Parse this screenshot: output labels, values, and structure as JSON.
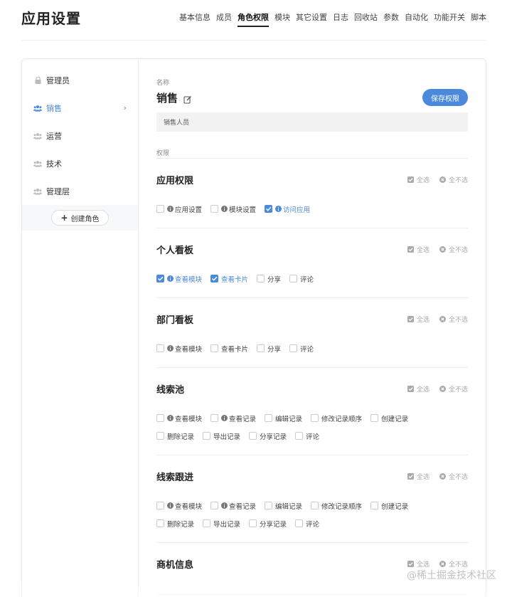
{
  "header": {
    "title": "应用设置",
    "tabs": [
      {
        "label": "基本信息",
        "active": false
      },
      {
        "label": "成员",
        "active": false
      },
      {
        "label": "角色权限",
        "active": true
      },
      {
        "label": "模块",
        "active": false
      },
      {
        "label": "其它设置",
        "active": false
      },
      {
        "label": "日志",
        "active": false
      },
      {
        "label": "回收站",
        "active": false
      },
      {
        "label": "参数",
        "active": false
      },
      {
        "label": "自动化",
        "active": false
      },
      {
        "label": "功能开关",
        "active": false
      },
      {
        "label": "脚本",
        "active": false
      }
    ]
  },
  "sidebar": {
    "roles": [
      {
        "label": "管理员",
        "icon": "lock-icon",
        "active": false
      },
      {
        "label": "销售",
        "icon": "users-icon",
        "active": true
      },
      {
        "label": "运营",
        "icon": "users-icon",
        "active": false
      },
      {
        "label": "技术",
        "icon": "users-icon",
        "active": false
      },
      {
        "label": "管理层",
        "icon": "users-icon",
        "active": false
      }
    ],
    "chevron": "›",
    "create_label": "创建角色"
  },
  "role": {
    "name_label": "名称",
    "name": "销售",
    "description": "销售人员",
    "save_label": "保存权限",
    "permissions_label": "权限"
  },
  "select_all_label": "全选",
  "deselect_all_label": "全不选",
  "groups": [
    {
      "title": "应用权限",
      "rows": [
        [
          {
            "label": "应用设置",
            "info": true,
            "checked": false
          },
          {
            "label": "模块设置",
            "info": true,
            "checked": false
          },
          {
            "label": "访问应用",
            "info": true,
            "checked": true
          }
        ]
      ]
    },
    {
      "title": "个人看板",
      "rows": [
        [
          {
            "label": "查看模块",
            "info": true,
            "checked": true
          },
          {
            "label": "查看卡片",
            "info": false,
            "checked": true
          },
          {
            "label": "分享",
            "info": false,
            "checked": false
          },
          {
            "label": "评论",
            "info": false,
            "checked": false
          }
        ]
      ]
    },
    {
      "title": "部门看板",
      "rows": [
        [
          {
            "label": "查看模块",
            "info": true,
            "checked": false
          },
          {
            "label": "查看卡片",
            "info": false,
            "checked": false
          },
          {
            "label": "分享",
            "info": false,
            "checked": false
          },
          {
            "label": "评论",
            "info": false,
            "checked": false
          }
        ]
      ]
    },
    {
      "title": "线索池",
      "rows": [
        [
          {
            "label": "查看模块",
            "info": true,
            "checked": false
          },
          {
            "label": "查看记录",
            "info": true,
            "checked": false
          },
          {
            "label": "编辑记录",
            "info": false,
            "checked": false
          },
          {
            "label": "修改记录顺序",
            "info": false,
            "checked": false
          },
          {
            "label": "创建记录",
            "info": false,
            "checked": false
          }
        ],
        [
          {
            "label": "删除记录",
            "info": false,
            "checked": false
          },
          {
            "label": "导出记录",
            "info": false,
            "checked": false
          },
          {
            "label": "分享记录",
            "info": false,
            "checked": false
          },
          {
            "label": "评论",
            "info": false,
            "checked": false
          }
        ]
      ]
    },
    {
      "title": "线索跟进",
      "rows": [
        [
          {
            "label": "查看模块",
            "info": true,
            "checked": false
          },
          {
            "label": "查看记录",
            "info": true,
            "checked": false
          },
          {
            "label": "编辑记录",
            "info": false,
            "checked": false
          },
          {
            "label": "修改记录顺序",
            "info": false,
            "checked": false
          },
          {
            "label": "创建记录",
            "info": false,
            "checked": false
          }
        ],
        [
          {
            "label": "删除记录",
            "info": false,
            "checked": false
          },
          {
            "label": "导出记录",
            "info": false,
            "checked": false
          },
          {
            "label": "分享记录",
            "info": false,
            "checked": false
          },
          {
            "label": "评论",
            "info": false,
            "checked": false
          }
        ]
      ]
    },
    {
      "title": "商机信息",
      "rows": []
    }
  ],
  "watermark": "@稀土掘金技术社区",
  "colors": {
    "accent": "#4a89dc",
    "muted": "#aaaaaa"
  }
}
